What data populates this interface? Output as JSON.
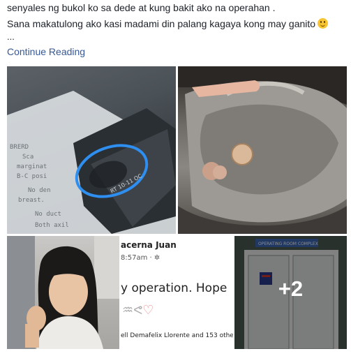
{
  "post": {
    "line1": "senyales ng bukol ko sa dede at kung bakit ako na operahan .",
    "line2": "Sana makatulong ako kasi madami din palang kagaya kong may ganito",
    "ellipsis": "...",
    "continue_label": "Continue Reading",
    "emoji_icon": "smiley-emoji-icon"
  },
  "photos": {
    "p1_label": "RT 10-11 OC",
    "p1_text": [
      "BRERD",
      "Sca",
      "marginat",
      "B-C posi",
      "No den",
      "breast.",
      "No duct",
      "Both axil"
    ],
    "p4_lines": {
      "name": "acerna Juan",
      "time": "8:57am · ",
      "headline": "y operation. Hope",
      "reactions": "",
      "footer": "ell Demafelix Llorente and 153 other"
    },
    "p5_sign": "OPERATING ROOM COMPLEX",
    "more_count": "+2"
  },
  "colors": {
    "link": "#365899",
    "text": "#1d2129",
    "highlight_circle": "#2f8ff0"
  }
}
